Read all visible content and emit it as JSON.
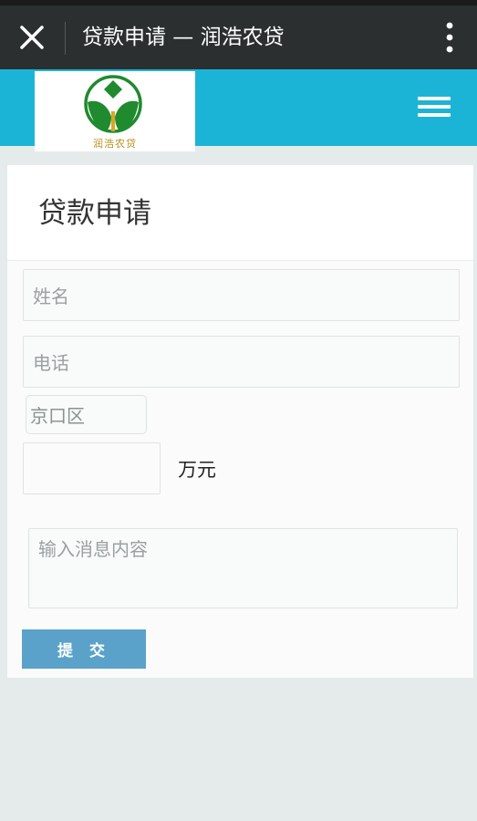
{
  "titlebar": {
    "title": "贷款申请 — 润浩农贷"
  },
  "header": {
    "logo_text": "润浩农贷"
  },
  "form": {
    "heading": "贷款申请",
    "name_placeholder": "姓名",
    "phone_placeholder": "电话",
    "district_value": "京口区",
    "amount_value": "",
    "amount_unit": "万元",
    "message_placeholder": "输入消息内容",
    "submit_label": "提 交"
  },
  "colors": {
    "titlebar_bg": "#2b2f30",
    "header_bg": "#1cb4d6",
    "submit_bg": "#5aa2c9",
    "logo_green": "#1f8a2e"
  },
  "icons": {
    "close": "close-icon",
    "more": "more-vertical-icon",
    "menu": "hamburger-menu-icon"
  }
}
